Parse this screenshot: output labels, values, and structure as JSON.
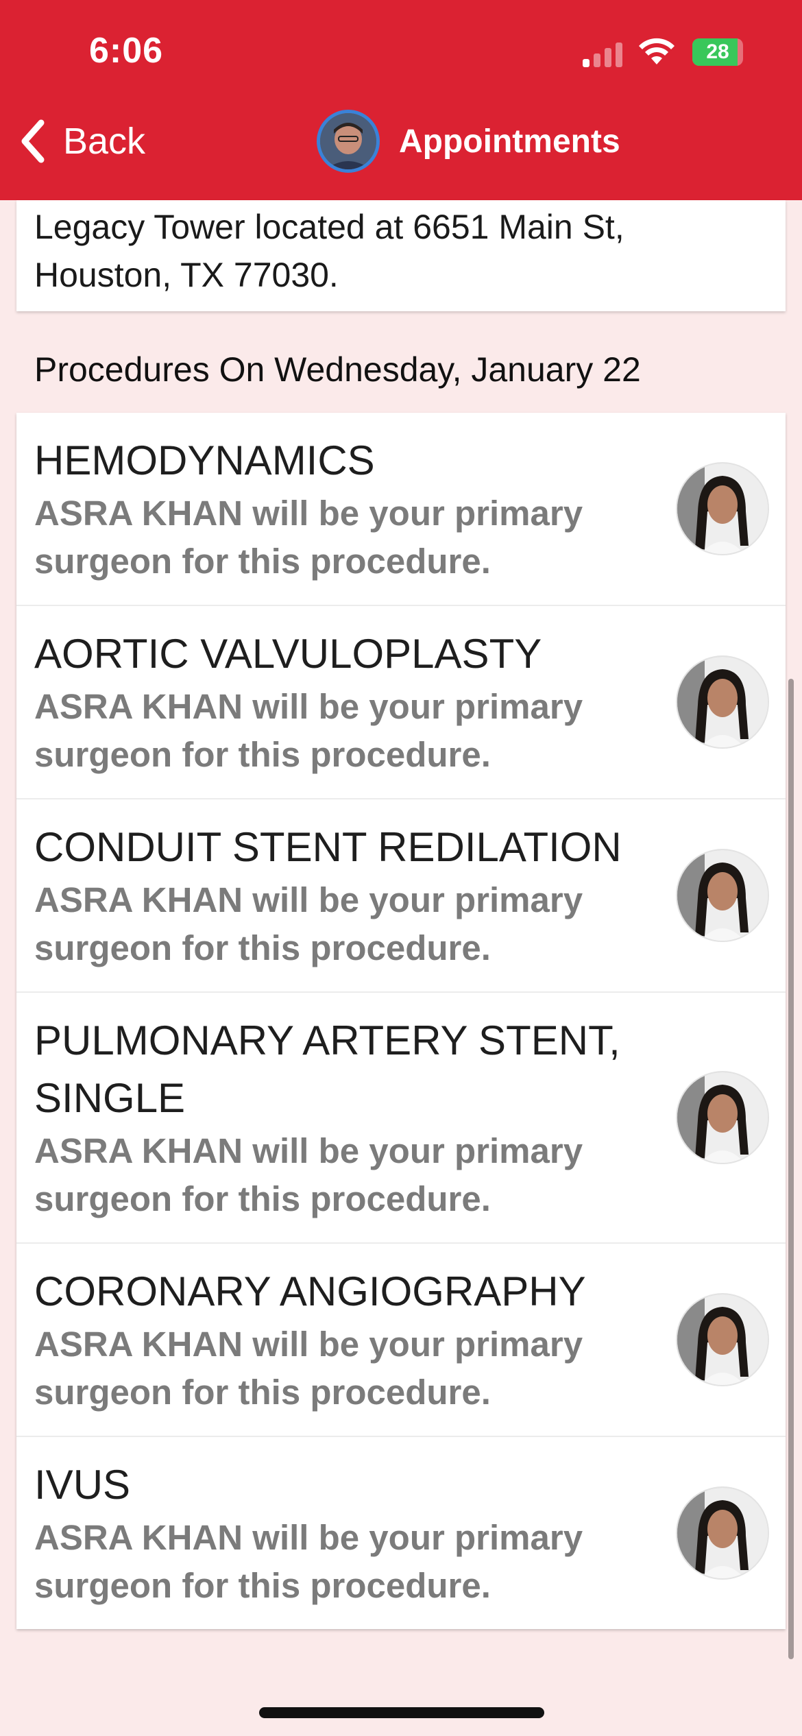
{
  "status_bar": {
    "time": "6:06",
    "battery": "28",
    "battery_level": 0.28
  },
  "nav": {
    "back_label": "Back",
    "title": "Appointments"
  },
  "address": {
    "text": "Legacy Tower located at 6651  Main St, Houston, TX 77030."
  },
  "section": {
    "heading": "Procedures On Wednesday, January 22"
  },
  "procedures": [
    {
      "name": "HEMODYNAMICS",
      "description": "ASRA KHAN will be your primary surgeon for this procedure."
    },
    {
      "name": "AORTIC VALVULOPLASTY",
      "description": "ASRA KHAN will be your primary surgeon for this procedure."
    },
    {
      "name": "CONDUIT STENT REDILATION",
      "description": "ASRA KHAN will be your primary surgeon for this procedure."
    },
    {
      "name": "PULMONARY ARTERY STENT, SINGLE",
      "description": "ASRA KHAN will be your primary surgeon for this procedure."
    },
    {
      "name": "CORONARY ANGIOGRAPHY",
      "description": "ASRA KHAN will be your primary surgeon for this procedure."
    },
    {
      "name": "IVUS",
      "description": "ASRA KHAN will be your primary surgeon for this procedure."
    }
  ],
  "colors": {
    "header_bg": "#db2232",
    "page_bg": "#fbeaea",
    "avatar_ring": "#3a82d8",
    "battery_fill": "#39c75a"
  }
}
